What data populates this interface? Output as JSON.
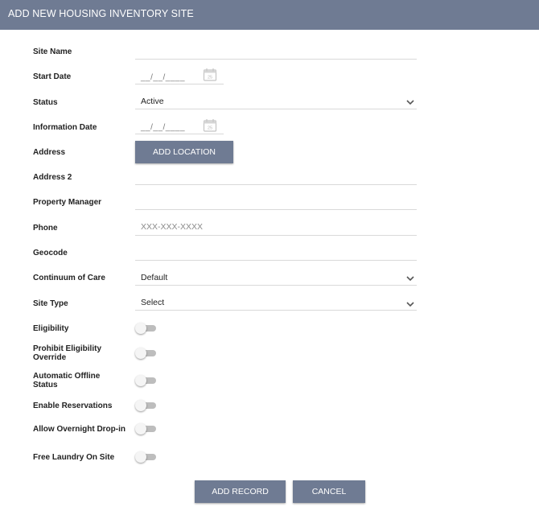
{
  "header": {
    "title": "ADD NEW HOUSING INVENTORY SITE"
  },
  "form": {
    "site_name": {
      "label": "Site Name",
      "value": ""
    },
    "start_date": {
      "label": "Start Date",
      "mask": "__/__/____"
    },
    "status": {
      "label": "Status",
      "value": "Active"
    },
    "information_date": {
      "label": "Information Date",
      "mask": "__/__/____"
    },
    "address": {
      "label": "Address",
      "button_label": "ADD LOCATION"
    },
    "address2": {
      "label": "Address 2",
      "value": ""
    },
    "property_manager": {
      "label": "Property Manager",
      "value": ""
    },
    "phone": {
      "label": "Phone",
      "placeholder": "XXX-XXX-XXXX"
    },
    "geocode": {
      "label": "Geocode",
      "value": ""
    },
    "continuum_of_care": {
      "label": "Continuum of Care",
      "value": "Default"
    },
    "site_type": {
      "label": "Site Type",
      "value": "Select"
    },
    "eligibility": {
      "label": "Eligibility",
      "on": false
    },
    "prohibit_eligibility_override": {
      "label": "Prohibit Eligibility Override",
      "on": false
    },
    "automatic_offline_status": {
      "label": "Automatic Offline Status",
      "on": false
    },
    "enable_reservations": {
      "label": "Enable Reservations",
      "on": false
    },
    "allow_overnight_dropin": {
      "label": "Allow Overnight Drop-in",
      "on": false
    },
    "free_laundry_on_site": {
      "label": "Free Laundry On Site",
      "on": false
    }
  },
  "actions": {
    "add_record": "ADD RECORD",
    "cancel": "CANCEL"
  },
  "colors": {
    "header_bg": "#6f7b93",
    "button_bg": "#6f7b93",
    "toggle_track": "#bdbdbd"
  },
  "icons": {
    "calendar": "calendar-icon",
    "dropdown": "chevron-down-icon"
  }
}
